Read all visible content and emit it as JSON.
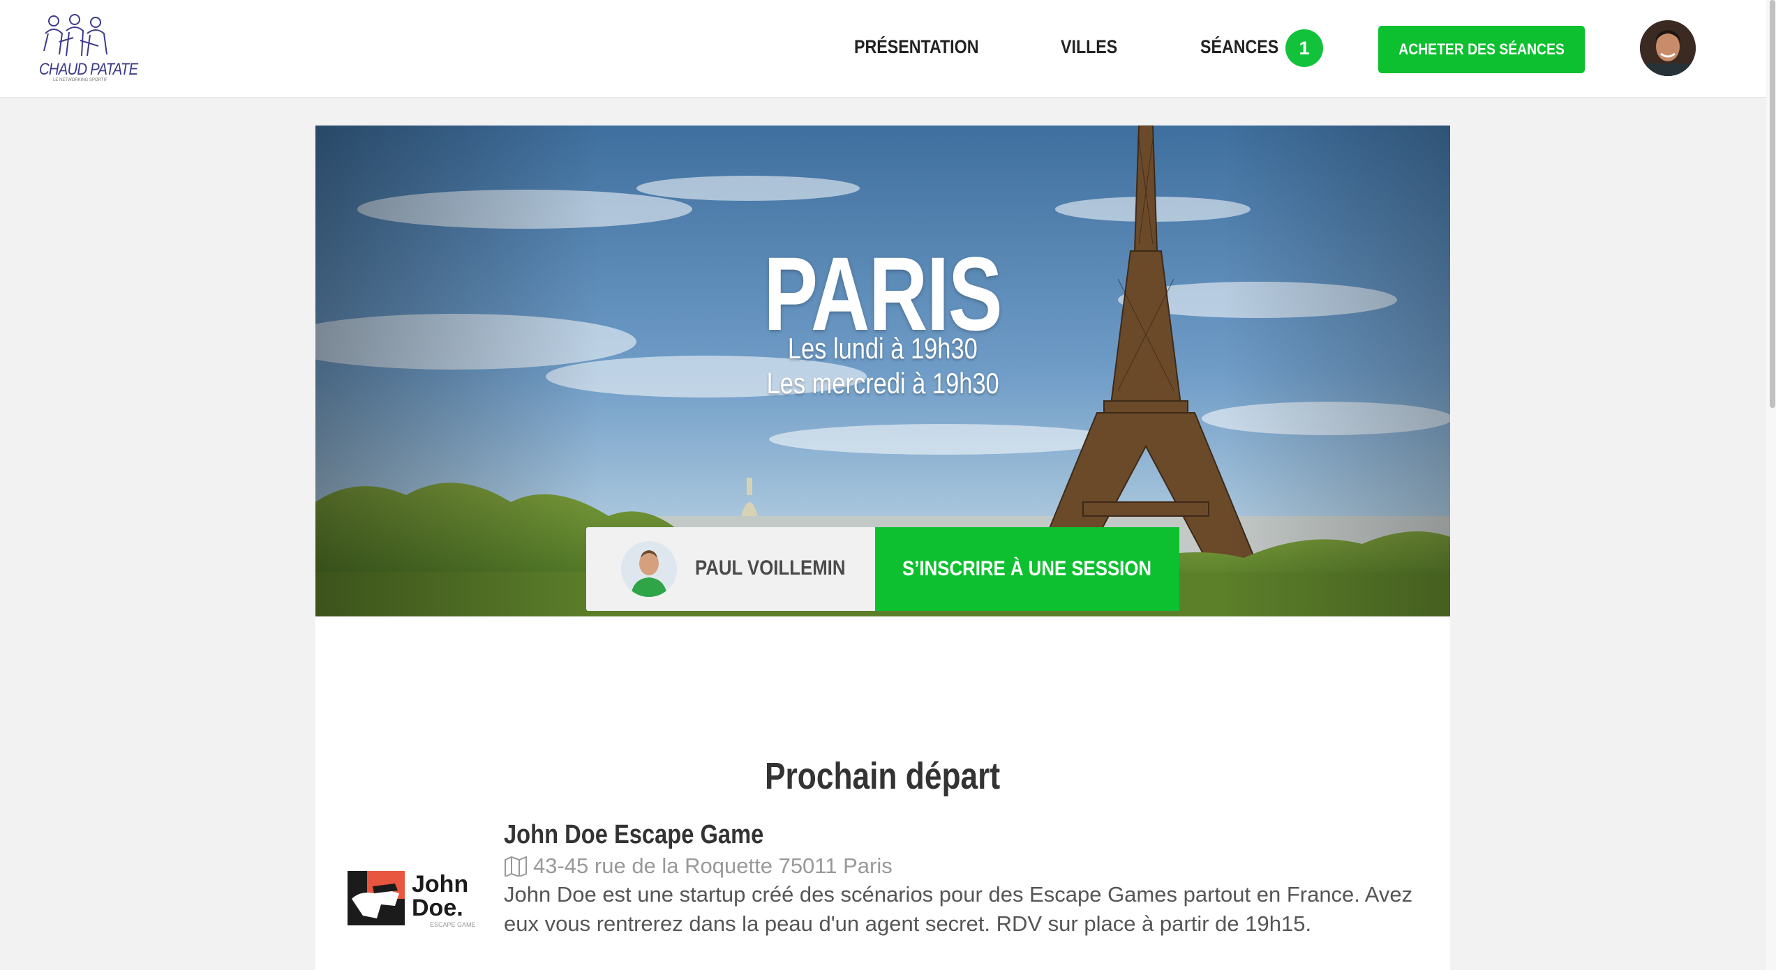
{
  "header": {
    "logo_text": "CHAUD PATATE",
    "logo_subtitle": "LE NETWORKING SPORTIF",
    "nav": [
      {
        "label": "PRÉSENTATION"
      },
      {
        "label": "VILLES"
      },
      {
        "label": "SÉANCES"
      }
    ],
    "sessions_badge": "1",
    "buy_button": "ACHETER DES SÉANCES",
    "avatar_icon": "user-avatar"
  },
  "hero": {
    "city": "PARIS",
    "schedule": [
      "Les lundi à 19h30",
      "Les mercredi à 19h30"
    ],
    "coach_name": "PAUL VOILLEMIN",
    "signup_button": "S’INSCRIRE À UNE SESSION"
  },
  "next_departure": {
    "title": "Prochain départ",
    "venue": {
      "name": "John Doe Escape Game",
      "address": "43-45 rue de la Roquette 75011 Paris",
      "description": "John Doe est une startup créé des scénarios pour des Escape Games partout en France. Avez eux vous rentrerez dans la peau d'un agent secret. RDV sur place à partir de 19h15.",
      "logo_line1": "John",
      "logo_line2": "Doe.",
      "logo_tagline": "ESCAPE GAME",
      "address_icon": "map-icon"
    }
  },
  "colors": {
    "accent_green": "#0dc02f",
    "logo_purple": "#3b3a8a",
    "background": "#f2f2f2"
  }
}
